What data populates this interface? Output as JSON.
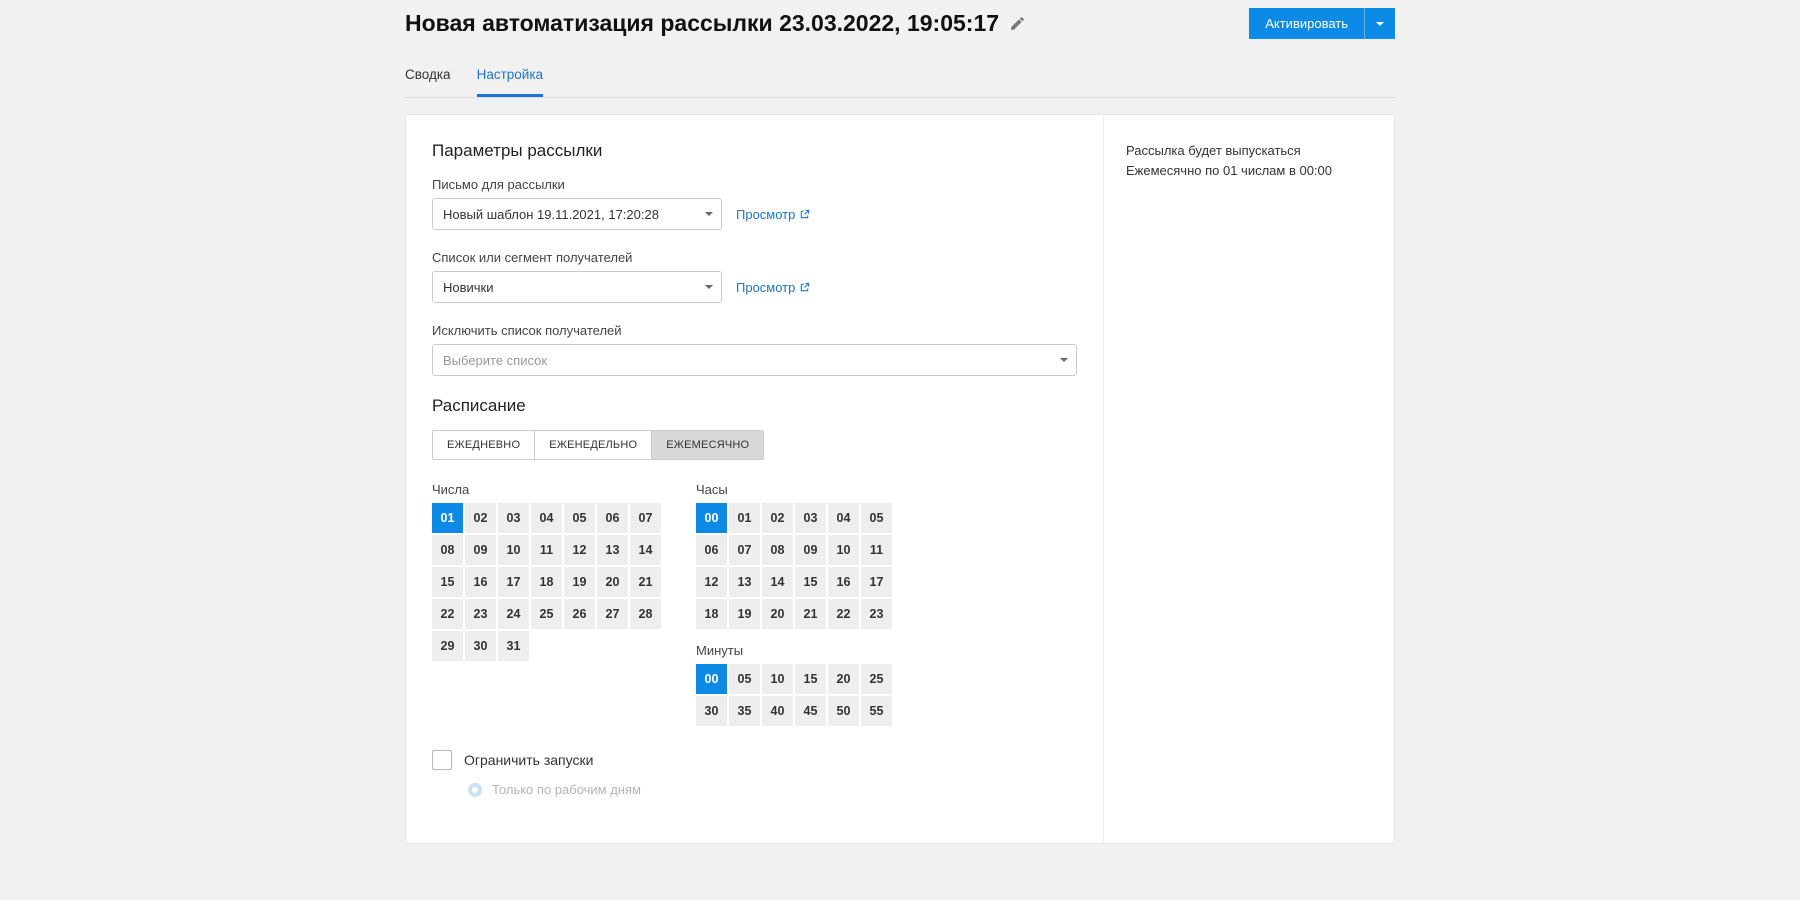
{
  "header": {
    "title": "Новая автоматизация рассылки 23.03.2022, 19:05:17",
    "activate": "Активировать"
  },
  "tabs": [
    "Сводка",
    "Настройка"
  ],
  "params": {
    "heading": "Параметры рассылки",
    "template_label": "Письмо для рассылки",
    "template_value": "Новый шаблон 19.11.2021, 17:20:28",
    "recipients_label": "Список или сегмент получателей",
    "recipients_value": "Новички",
    "exclude_label": "Исключить список получателей",
    "exclude_placeholder": "Выберите список",
    "preview": "Просмотр"
  },
  "schedule": {
    "heading": "Расписание",
    "tabs": [
      "ЕЖЕДНЕВНО",
      "ЕЖЕНЕДЕЛЬНО",
      "ЕЖЕМЕСЯЧНО"
    ],
    "days_label": "Числа",
    "hours_label": "Часы",
    "minutes_label": "Минуты",
    "days": [
      "01",
      "02",
      "03",
      "04",
      "05",
      "06",
      "07",
      "08",
      "09",
      "10",
      "11",
      "12",
      "13",
      "14",
      "15",
      "16",
      "17",
      "18",
      "19",
      "20",
      "21",
      "22",
      "23",
      "24",
      "25",
      "26",
      "27",
      "28",
      "29",
      "30",
      "31"
    ],
    "days_selected": [
      "01"
    ],
    "hours": [
      "00",
      "01",
      "02",
      "03",
      "04",
      "05",
      "06",
      "07",
      "08",
      "09",
      "10",
      "11",
      "12",
      "13",
      "14",
      "15",
      "16",
      "17",
      "18",
      "19",
      "20",
      "21",
      "22",
      "23"
    ],
    "hours_selected": [
      "00"
    ],
    "minutes": [
      "00",
      "05",
      "10",
      "15",
      "20",
      "25",
      "30",
      "35",
      "40",
      "45",
      "50",
      "55"
    ],
    "minutes_selected": [
      "00"
    ]
  },
  "limits": {
    "limit_label": "Ограничить запуски",
    "workdays_label": "Только по рабочим дням"
  },
  "side": {
    "line1": "Рассылка будет выпускаться",
    "line2": "Ежемесячно по 01 числам в 00:00"
  }
}
